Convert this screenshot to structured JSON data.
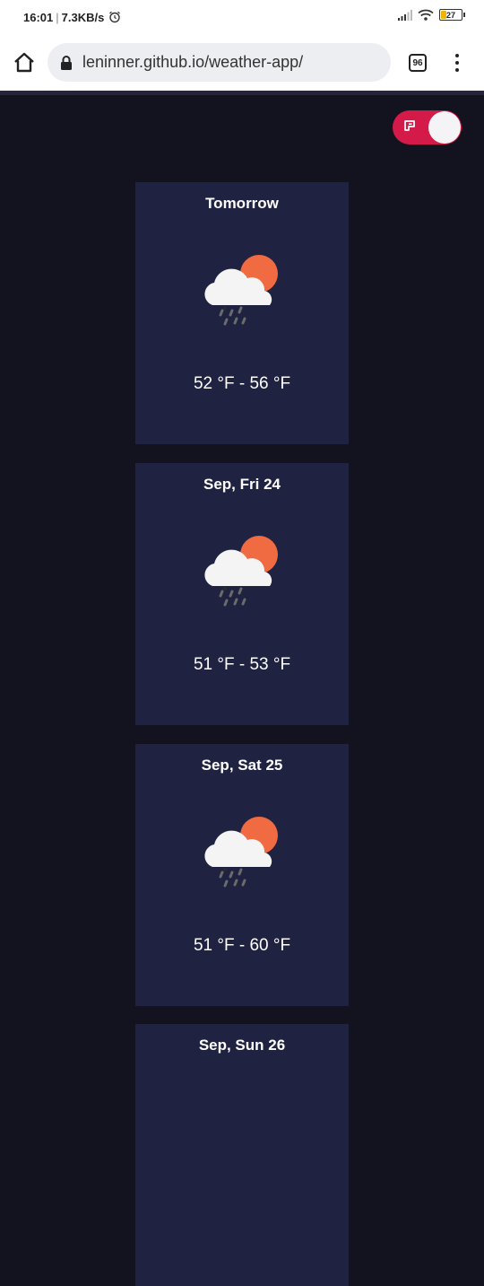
{
  "status_bar": {
    "time": "16:01",
    "speed": "7.3KB/s",
    "battery": "27"
  },
  "browser": {
    "url": "leninner.github.io/weather-app/",
    "tab_count": "96"
  },
  "theme": {
    "toggle_color": "#d31a48"
  },
  "colors": {
    "page_bg": "#13121f",
    "card_bg": "#1f2240",
    "sun": "#f06a42",
    "cloud": "#f4f4f4",
    "rain": "#6b6b6b"
  },
  "forecast": [
    {
      "day": "Tomorrow",
      "range": "52 °F - 56 °F",
      "icon": "rain-cloud-sun-icon"
    },
    {
      "day": "Sep, Fri 24",
      "range": "51 °F - 53 °F",
      "icon": "rain-cloud-sun-icon"
    },
    {
      "day": "Sep, Sat 25",
      "range": "51 °F - 60 °F",
      "icon": "rain-cloud-sun-icon"
    },
    {
      "day": "Sep, Sun 26",
      "range": "",
      "icon": "rain-cloud-sun-icon"
    }
  ]
}
